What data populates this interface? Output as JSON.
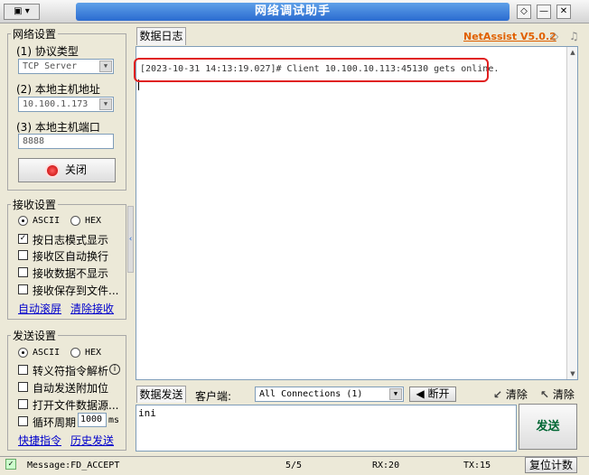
{
  "window": {
    "title": "网络调试助手",
    "menu_button": "▾",
    "btn_pin": "◇",
    "btn_minimize": "—",
    "btn_close": "✕"
  },
  "network": {
    "group_title": "网络设置",
    "protocol_label": "(1) 协议类型",
    "protocol_value": "TCP Server",
    "host_label": "(2) 本地主机地址",
    "host_value": "10.100.1.173",
    "port_label": "(3) 本地主机端口",
    "port_value": "8888",
    "close_button": "关闭"
  },
  "receive": {
    "group_title": "接收设置",
    "ascii": "ASCII",
    "hex": "HEX",
    "opt1": "按日志模式显示",
    "opt2": "接收区自动换行",
    "opt3": "接收数据不显示",
    "opt4": "接收保存到文件...",
    "link_scroll": "自动滚屏",
    "link_clear": "清除接收"
  },
  "send": {
    "group_title": "发送设置",
    "ascii": "ASCII",
    "hex": "HEX",
    "opt1": "转义符指令解析",
    "opt2": "自动发送附加位",
    "opt3": "打开文件数据源...",
    "opt4": "循环周期",
    "cycle_value": "1000",
    "cycle_unit": "ms",
    "link_shortcut": "快捷指令",
    "link_history": "历史发送"
  },
  "log": {
    "tab": "数据日志",
    "brand": "NetAssist V5.0.2",
    "line": "[2023-10-31 14:13:19.027]# Client 10.100.10.113:45130 gets online."
  },
  "send_bar": {
    "tab": "数据发送",
    "client_label": "客户端:",
    "client_value": "All Connections (1)",
    "disconnect": "断开",
    "clear1": "清除",
    "clear2": "清除",
    "send_text": "ini",
    "send_button": "发送"
  },
  "status": {
    "message": "Message:FD_ACCEPT",
    "count": "5/5",
    "rx": "RX:20",
    "tx": "TX:15",
    "reset": "复位计数"
  }
}
